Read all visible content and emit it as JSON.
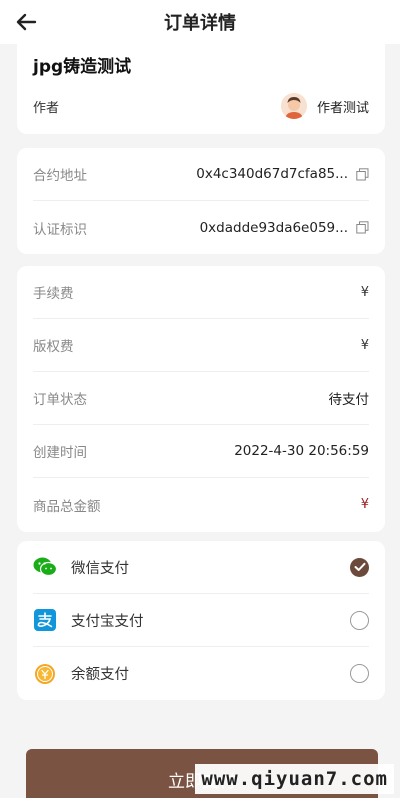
{
  "header": {
    "title": "订单详情",
    "back_icon": "arrow-left-icon"
  },
  "product": {
    "title": "jpg铸造测试",
    "author_label": "作者",
    "author_name": "作者测试"
  },
  "contract": {
    "rows": [
      {
        "label": "合约地址",
        "value": "0x4c340d67d7cfa85...",
        "icon": "copy-icon"
      },
      {
        "label": "认证标识",
        "value": "0xdadde93da6e059...",
        "icon": "copy-icon"
      }
    ]
  },
  "order": {
    "rows": [
      {
        "label": "手续费",
        "value": "¥"
      },
      {
        "label": "版权费",
        "value": "¥"
      },
      {
        "label": "订单状态",
        "value": "待支付"
      },
      {
        "label": "创建时间",
        "value": "2022-4-30 20:56:59"
      },
      {
        "label": "商品总金额",
        "value": "¥"
      }
    ],
    "total_color": "#9b1c1c"
  },
  "payment": {
    "options": [
      {
        "label": "微信支付",
        "icon": "wechat-pay-icon",
        "checked": true
      },
      {
        "label": "支付宝支付",
        "icon": "alipay-icon",
        "checked": false
      },
      {
        "label": "余额支付",
        "icon": "balance-coin-icon",
        "checked": false
      }
    ],
    "accent": "#6b4a3c"
  },
  "submit": {
    "label": "立即支付"
  },
  "watermark": {
    "text": "www.qiyuan7.com"
  }
}
